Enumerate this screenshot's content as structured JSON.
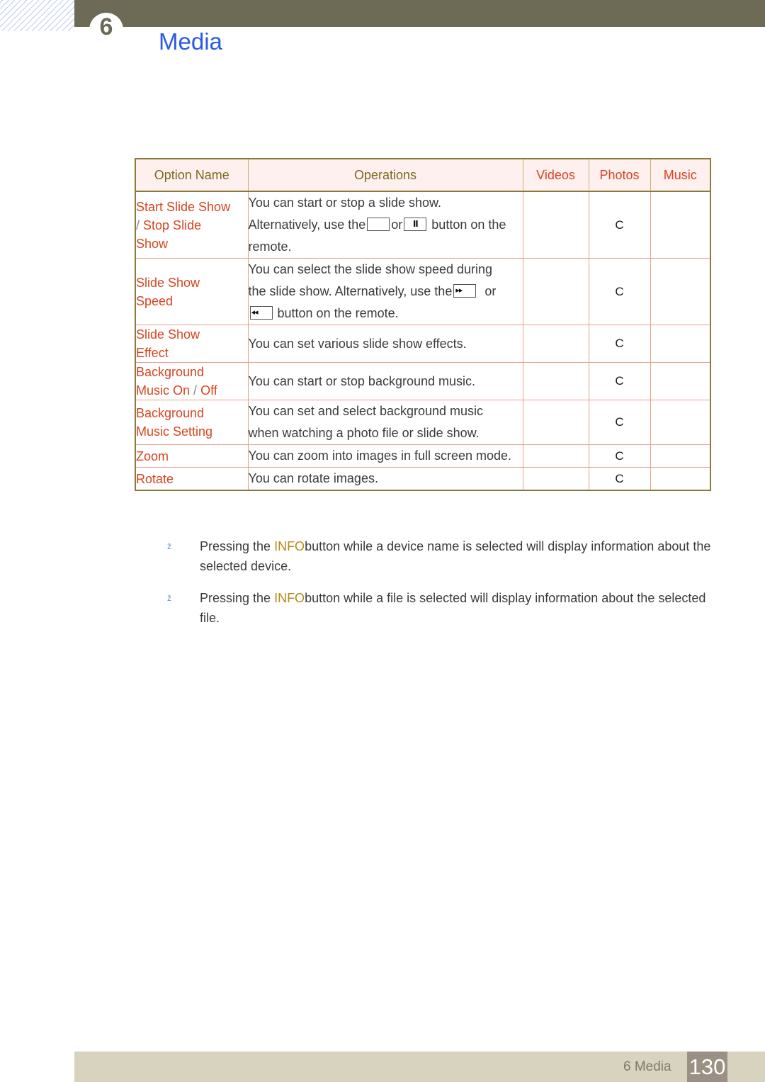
{
  "decor": {
    "hatch_name": "diagonal-hatch-pattern"
  },
  "header": {
    "chapter_number": "6",
    "title": "Media"
  },
  "table": {
    "columns": [
      "Option Name",
      "Operations",
      "Videos",
      "Photos",
      "Music"
    ],
    "rows": [
      {
        "option": "Start Slide Show",
        "option_separator": "/",
        "option_second": "Stop Slide",
        "option_third": "Show",
        "operations_line1": "You can start or stop a slide show.",
        "operations_line2_a": "Alternatively, use the",
        "operations_key1": "",
        "operations_line2_b": "or",
        "operations_key2": "II",
        "operations_line2_c": "button on the",
        "operations_line3": "remote.",
        "videos": "",
        "photos": "C",
        "music": ""
      },
      {
        "option": "Slide Show",
        "option_second": "Speed",
        "operations_line1": "You can select the slide show speed during",
        "operations_line2_a": "the slide show. Alternatively, use the",
        "operations_key1": "▸▸",
        "operations_line2_b": "or",
        "operations_key2": "◂◂",
        "operations_line3": "button on the remote.",
        "videos": "",
        "photos": "C",
        "music": ""
      },
      {
        "option": "Slide Show",
        "option_second": "Effect",
        "operations_line1": "You can set various slide show effects.",
        "videos": "",
        "photos": "C",
        "music": ""
      },
      {
        "option": "Background",
        "option_second": "Music On",
        "option_separator": "/",
        "option_third": "Off",
        "operations_line1": "You can start or stop background music.",
        "videos": "",
        "photos": "C",
        "music": ""
      },
      {
        "option": "Background",
        "option_second": "Music Setting",
        "operations_line1": "You can set and select background music",
        "operations_line2": "when watching a photo file or slide show.",
        "videos": "",
        "photos": "C",
        "music": ""
      },
      {
        "option": "Zoom",
        "operations_line1": "You can zoom into images in full screen mode.",
        "videos": "",
        "photos": "C",
        "music": ""
      },
      {
        "option": "Rotate",
        "operations_line1": "You can rotate images.",
        "videos": "",
        "photos": "C",
        "music": ""
      }
    ]
  },
  "notes": [
    {
      "bullet": "ž",
      "text_before": "Pressing the ",
      "keyword": "INFO",
      "text_after": "button while a device name is selected will display information about the selected device."
    },
    {
      "bullet": "ž",
      "text_before": "Pressing the ",
      "keyword": "INFO",
      "text_after": "button while a file is selected will display information about the selected file."
    }
  ],
  "footer": {
    "chapter_label": "6 Media",
    "page_number": "130"
  },
  "colors": {
    "header_band": "#6d6b55",
    "title_blue": "#2b59e8",
    "option_orange": "#d9431f",
    "header_olive": "#7b6a1f",
    "table_border_outer": "#8a7a3a",
    "table_border_inner": "#e8a08a",
    "table_header_bg": "#fdf0ee",
    "footer_bg": "#d8d3bf",
    "footer_page_bg": "#9a9083",
    "info_keyword": "#b58a14"
  }
}
